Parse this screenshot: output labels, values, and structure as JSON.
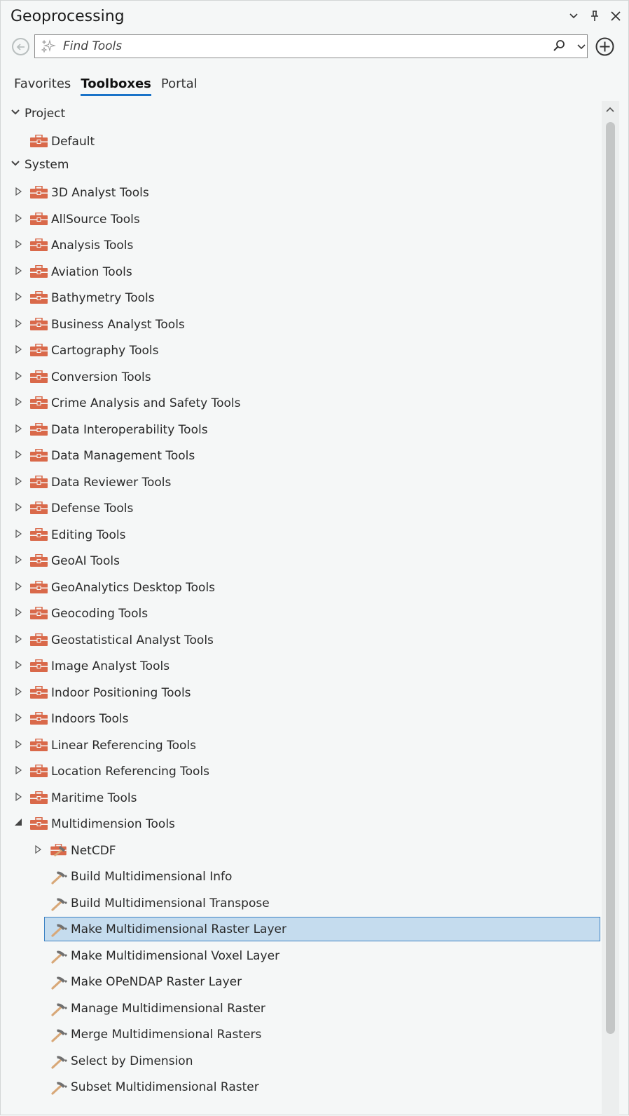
{
  "window": {
    "title": "Geoprocessing",
    "controls": [
      "chevron-down-icon",
      "pin-icon",
      "close-icon"
    ]
  },
  "search": {
    "placeholder": "Find Tools",
    "icons": [
      "sparkle-icon",
      "search-icon",
      "chevron-down-icon"
    ]
  },
  "tabs": [
    {
      "label": "Favorites",
      "active": false
    },
    {
      "label": "Toolboxes",
      "active": true
    },
    {
      "label": "Portal",
      "active": false
    }
  ],
  "tree": {
    "project": {
      "label": "Project",
      "items": [
        {
          "label": "Default"
        }
      ]
    },
    "system": {
      "label": "System",
      "toolboxes": [
        {
          "label": "3D Analyst Tools"
        },
        {
          "label": "AllSource Tools"
        },
        {
          "label": "Analysis Tools"
        },
        {
          "label": "Aviation Tools"
        },
        {
          "label": "Bathymetry Tools"
        },
        {
          "label": "Business Analyst Tools"
        },
        {
          "label": "Cartography Tools"
        },
        {
          "label": "Conversion Tools"
        },
        {
          "label": "Crime Analysis and Safety Tools"
        },
        {
          "label": "Data Interoperability Tools"
        },
        {
          "label": "Data Management Tools"
        },
        {
          "label": "Data Reviewer Tools"
        },
        {
          "label": "Defense Tools"
        },
        {
          "label": "Editing Tools"
        },
        {
          "label": "GeoAI Tools"
        },
        {
          "label": "GeoAnalytics Desktop Tools"
        },
        {
          "label": "Geocoding Tools"
        },
        {
          "label": "Geostatistical Analyst Tools"
        },
        {
          "label": "Image Analyst Tools"
        },
        {
          "label": "Indoor Positioning Tools"
        },
        {
          "label": "Indoors Tools"
        },
        {
          "label": "Linear Referencing Tools"
        },
        {
          "label": "Location Referencing Tools"
        },
        {
          "label": "Maritime Tools"
        },
        {
          "label": "Multidimension Tools"
        }
      ],
      "multidimension": {
        "toolset": "NetCDF",
        "tools": [
          {
            "label": "Build Multidimensional Info",
            "selected": false
          },
          {
            "label": "Build Multidimensional Transpose",
            "selected": false
          },
          {
            "label": "Make Multidimensional Raster Layer",
            "selected": true
          },
          {
            "label": "Make Multidimensional Voxel Layer",
            "selected": false
          },
          {
            "label": "Make OPeNDAP Raster Layer",
            "selected": false
          },
          {
            "label": "Manage Multidimensional Raster",
            "selected": false
          },
          {
            "label": "Merge Multidimensional Rasters",
            "selected": false
          },
          {
            "label": "Select by Dimension",
            "selected": false
          },
          {
            "label": "Subset Multidimensional Raster",
            "selected": false
          }
        ]
      }
    }
  },
  "colors": {
    "accent": "#1a73c8",
    "toolbox": "#d9694a",
    "selection": "#c5dcee",
    "selection_border": "#3c82c4",
    "hammer_handle": "#d8a878",
    "hammer_head": "#707070"
  }
}
